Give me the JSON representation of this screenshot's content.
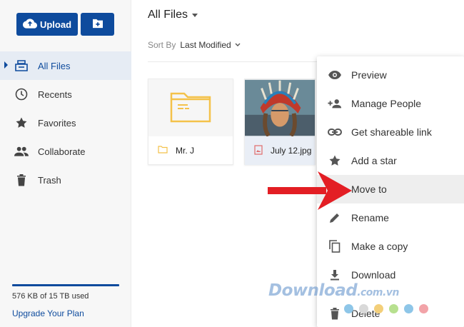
{
  "sidebar": {
    "upload_label": "Upload",
    "items": [
      {
        "label": "All Files",
        "icon": "all-files-icon"
      },
      {
        "label": "Recents",
        "icon": "clock-icon"
      },
      {
        "label": "Favorites",
        "icon": "star-icon"
      },
      {
        "label": "Collaborate",
        "icon": "people-icon"
      },
      {
        "label": "Trash",
        "icon": "trash-icon"
      }
    ],
    "active_item": "All Files",
    "storage_text": "576 KB of 15 TB used",
    "upgrade_label": "Upgrade Your Plan"
  },
  "main": {
    "title": "All Files",
    "sort_label": "Sort By",
    "sort_value": "Last Modified",
    "files": [
      {
        "name": "Mr. J",
        "type": "folder"
      },
      {
        "name": "July 12.jpg",
        "type": "image",
        "selected": true
      }
    ]
  },
  "context_menu": {
    "items": [
      {
        "label": "Preview",
        "icon": "eye-icon"
      },
      {
        "label": "Manage People",
        "icon": "add-person-icon"
      },
      {
        "label": "Get shareable link",
        "icon": "link-icon"
      },
      {
        "label": "Add a star",
        "icon": "star-icon"
      },
      {
        "label": "Move to",
        "icon": "move-icon",
        "highlighted": true
      },
      {
        "label": "Rename",
        "icon": "pencil-icon"
      },
      {
        "label": "Make a copy",
        "icon": "copy-icon"
      },
      {
        "label": "Download",
        "icon": "download-icon"
      },
      {
        "label": "Delete",
        "icon": "trash-icon"
      }
    ]
  },
  "watermark": {
    "text": "Download",
    "suffix": ".com.vn",
    "dot_colors": [
      "#8ec6e8",
      "#d9d9d9",
      "#f3cf7a",
      "#b7e08f",
      "#8ec6e8",
      "#f2a3a8"
    ]
  },
  "colors": {
    "accent": "#0e4b9d",
    "folder": "#f4c24a",
    "annotation_arrow": "#e31e24"
  }
}
